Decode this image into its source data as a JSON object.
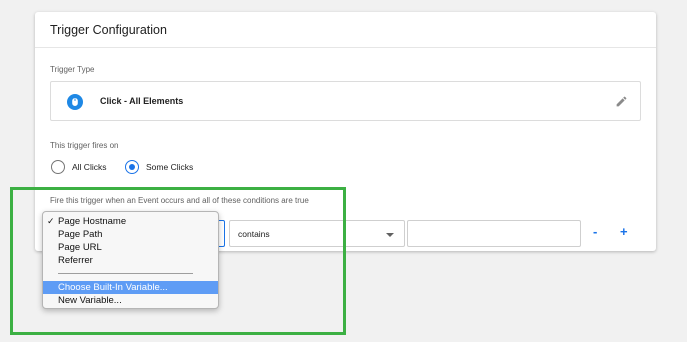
{
  "card": {
    "title": "Trigger Configuration",
    "trigger_type_label": "Trigger Type",
    "trigger_type": {
      "name": "Click - All Elements",
      "icon": "click-cursor-icon",
      "edit_icon": "pencil-icon"
    },
    "fires_on_label": "This trigger fires on",
    "fires_on_options": [
      {
        "label": "All Clicks",
        "checked": false
      },
      {
        "label": "Some Clicks",
        "checked": true
      }
    ],
    "condition_label": "Fire this trigger when an Event occurs and all of these conditions are true",
    "condition": {
      "operator": "contains",
      "value": "",
      "remove_label": "-",
      "add_label": "+"
    }
  },
  "variable_dropdown": {
    "items": [
      {
        "label": "Page Hostname",
        "checked": true
      },
      {
        "label": "Page Path",
        "checked": false
      },
      {
        "label": "Page URL",
        "checked": false
      },
      {
        "label": "Referrer",
        "checked": false
      }
    ],
    "check_mark": "✓",
    "actions": [
      {
        "label": "Choose Built-In Variable...",
        "highlighted": true
      },
      {
        "label": "New Variable...",
        "highlighted": false
      }
    ]
  },
  "colors": {
    "accent": "#1a73e8",
    "highlight_box": "#3cb043",
    "menu_selection": "#5e9cf5"
  }
}
